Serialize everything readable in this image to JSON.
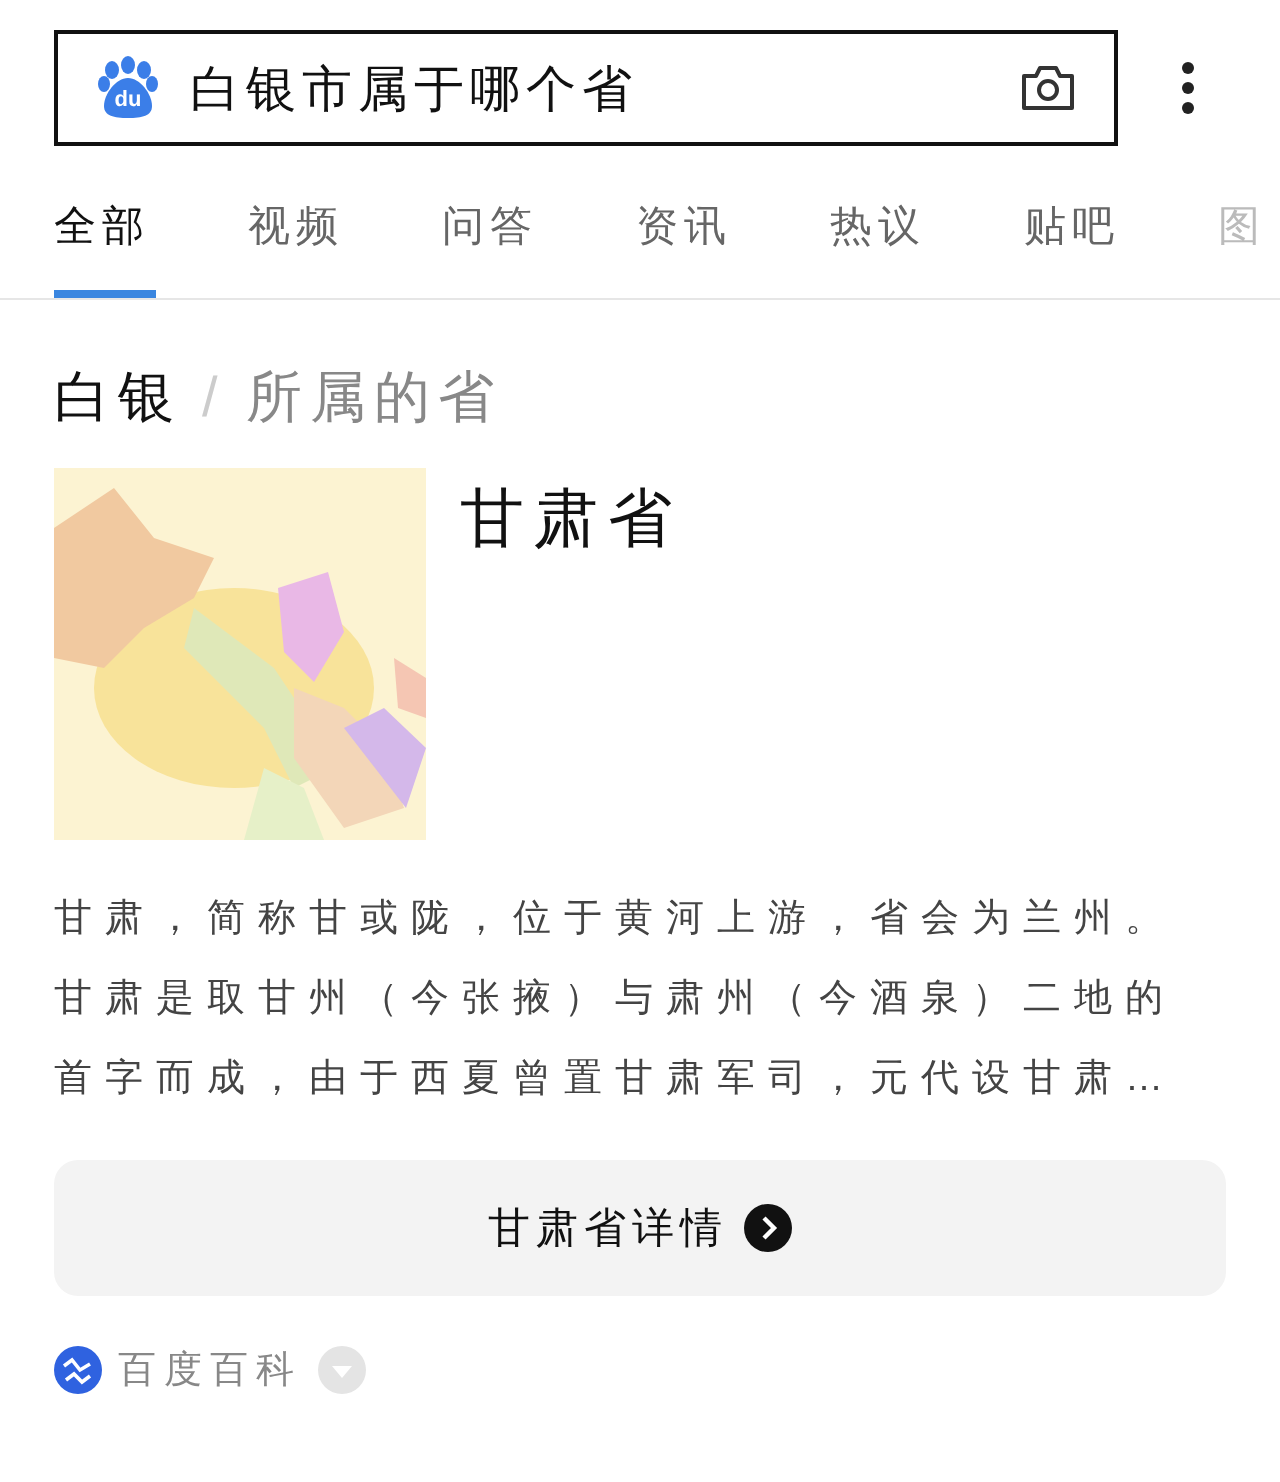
{
  "search": {
    "logo_text": "du",
    "value": "白银市属于哪个省"
  },
  "tabs": [
    {
      "label": "全部",
      "selected": true
    },
    {
      "label": "视频",
      "selected": false
    },
    {
      "label": "问答",
      "selected": false
    },
    {
      "label": "资讯",
      "selected": false
    },
    {
      "label": "热议",
      "selected": false
    },
    {
      "label": "贴吧",
      "selected": false
    },
    {
      "label": "图",
      "selected": false
    }
  ],
  "card": {
    "subject": "白银",
    "separator": "/",
    "relation": "所属的省",
    "answer": "甘肃省",
    "description": "甘肃，简称甘或陇，位于黄河上游，省会为兰州。甘肃是取甘州（今张掖）与肃州（今酒泉）二地的首字而成，由于西夏曾置甘肃军司，元代设甘肃…",
    "details_button": "甘肃省详情",
    "source": "百度百科"
  }
}
